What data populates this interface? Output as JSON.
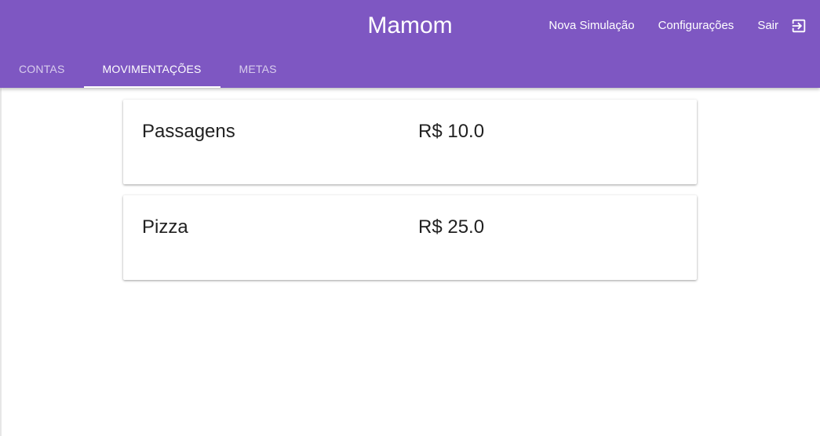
{
  "app": {
    "title": "Mamom"
  },
  "nav": {
    "new_simulation": "Nova Simulação",
    "settings": "Configurações",
    "logout": "Sair",
    "logout_icon": "exit-to-app-icon"
  },
  "tabs": [
    {
      "label": "CONTAS",
      "active": false
    },
    {
      "label": "MOVIMENTAÇÕES",
      "active": true
    },
    {
      "label": "METAS",
      "active": false
    }
  ],
  "movements": [
    {
      "name": "Passagens",
      "value": "R$ 10.0"
    },
    {
      "name": "Pizza",
      "value": "R$ 25.0"
    }
  ],
  "colors": {
    "primary": "#7e57c2",
    "text": "#212121",
    "on_primary": "#ffffff"
  }
}
